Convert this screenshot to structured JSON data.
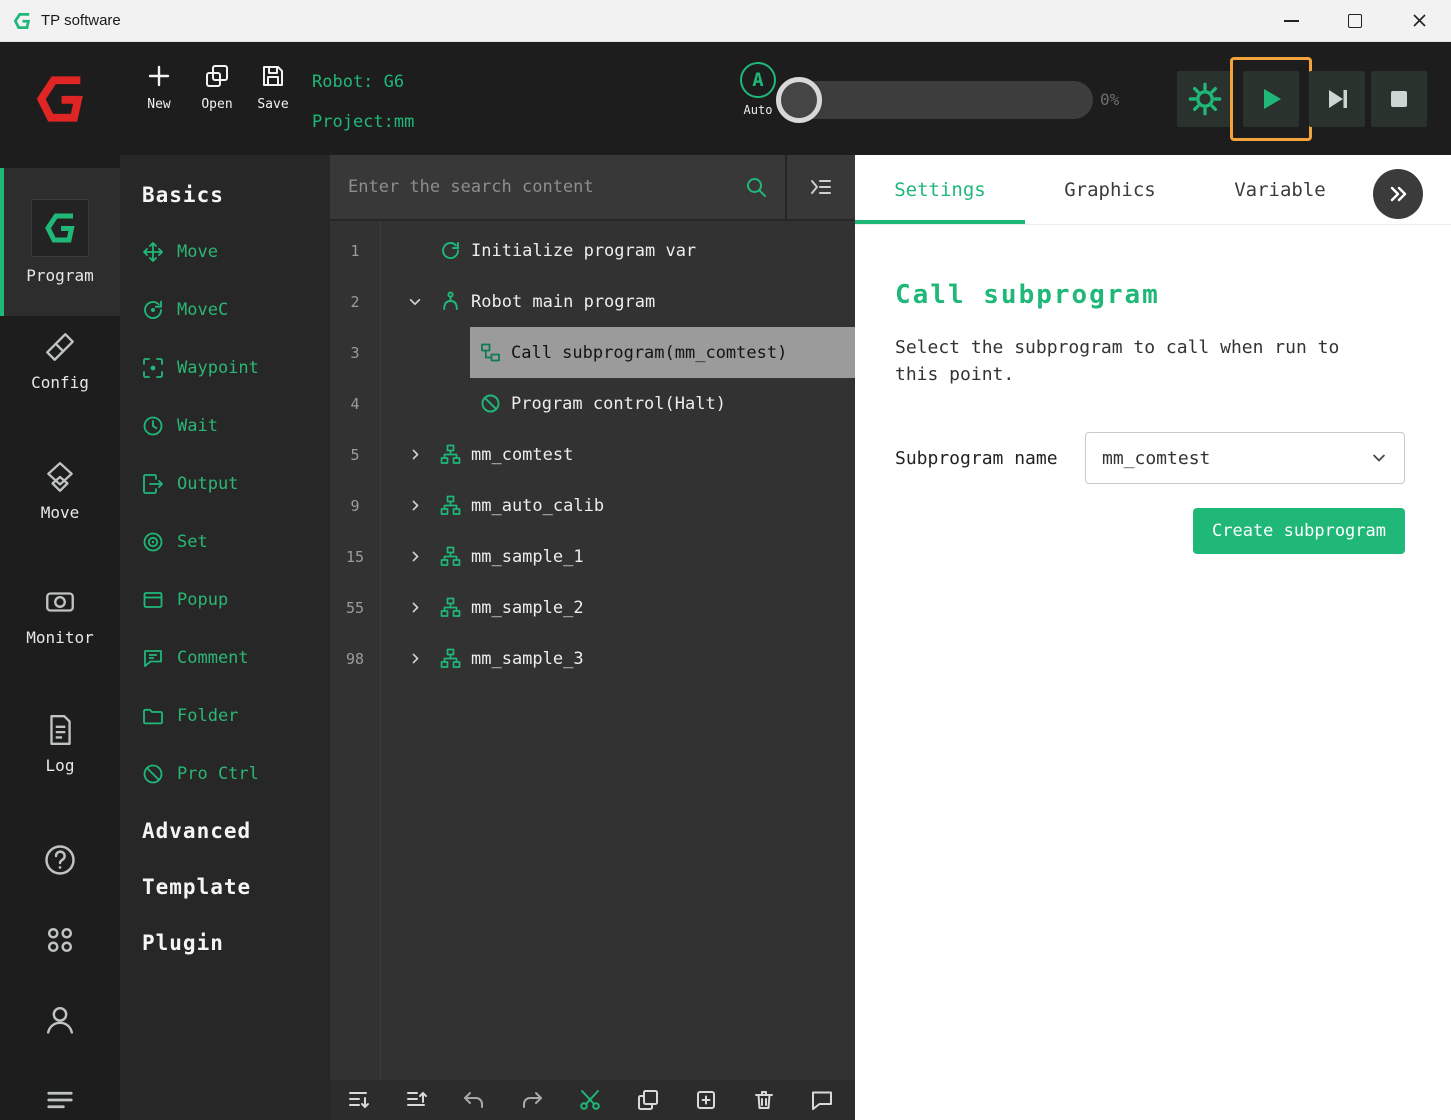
{
  "colors": {
    "accent": "#1fb878",
    "logo_red": "#e02525",
    "play_highlight": "#f2a33c"
  },
  "titlebar": {
    "app_name": "TP software"
  },
  "topbar": {
    "new_label": "New",
    "open_label": "Open",
    "save_label": "Save",
    "robot_label": "Robot: G6",
    "project_label": "Project:mm",
    "auto_letter": "A",
    "auto_label": "Auto",
    "progress_value": "0%"
  },
  "sidebar": {
    "items": [
      {
        "label": "Program"
      },
      {
        "label": "Config"
      },
      {
        "label": "Move"
      },
      {
        "label": "Monitor"
      },
      {
        "label": "Log"
      }
    ]
  },
  "commands": {
    "basics_header": "Basics",
    "items": [
      {
        "label": "Move"
      },
      {
        "label": "MoveC"
      },
      {
        "label": "Waypoint"
      },
      {
        "label": "Wait"
      },
      {
        "label": "Output"
      },
      {
        "label": "Set"
      },
      {
        "label": "Popup"
      },
      {
        "label": "Comment"
      },
      {
        "label": "Folder"
      },
      {
        "label": "Pro Ctrl"
      }
    ],
    "advanced_header": "Advanced",
    "template_header": "Template",
    "plugin_header": "Plugin"
  },
  "tree": {
    "search_placeholder": "Enter the search content",
    "rows": [
      {
        "num": "1",
        "label": "Initialize program var"
      },
      {
        "num": "2",
        "label": "Robot main program"
      },
      {
        "num": "3",
        "label": "Call subprogram(mm_comtest)"
      },
      {
        "num": "4",
        "label": "Program control(Halt)"
      },
      {
        "num": "5",
        "label": "mm_comtest"
      },
      {
        "num": "9",
        "label": "mm_auto_calib"
      },
      {
        "num": "15",
        "label": "mm_sample_1"
      },
      {
        "num": "55",
        "label": "mm_sample_2"
      },
      {
        "num": "98",
        "label": "mm_sample_3"
      }
    ]
  },
  "panel": {
    "tabs": [
      {
        "label": "Settings"
      },
      {
        "label": "Graphics"
      },
      {
        "label": "Variable"
      }
    ],
    "heading": "Call subprogram",
    "description": "Select the subprogram to call when run to this point.",
    "field_label": "Subprogram name",
    "field_value": "mm_comtest",
    "create_button": "Create subprogram"
  }
}
